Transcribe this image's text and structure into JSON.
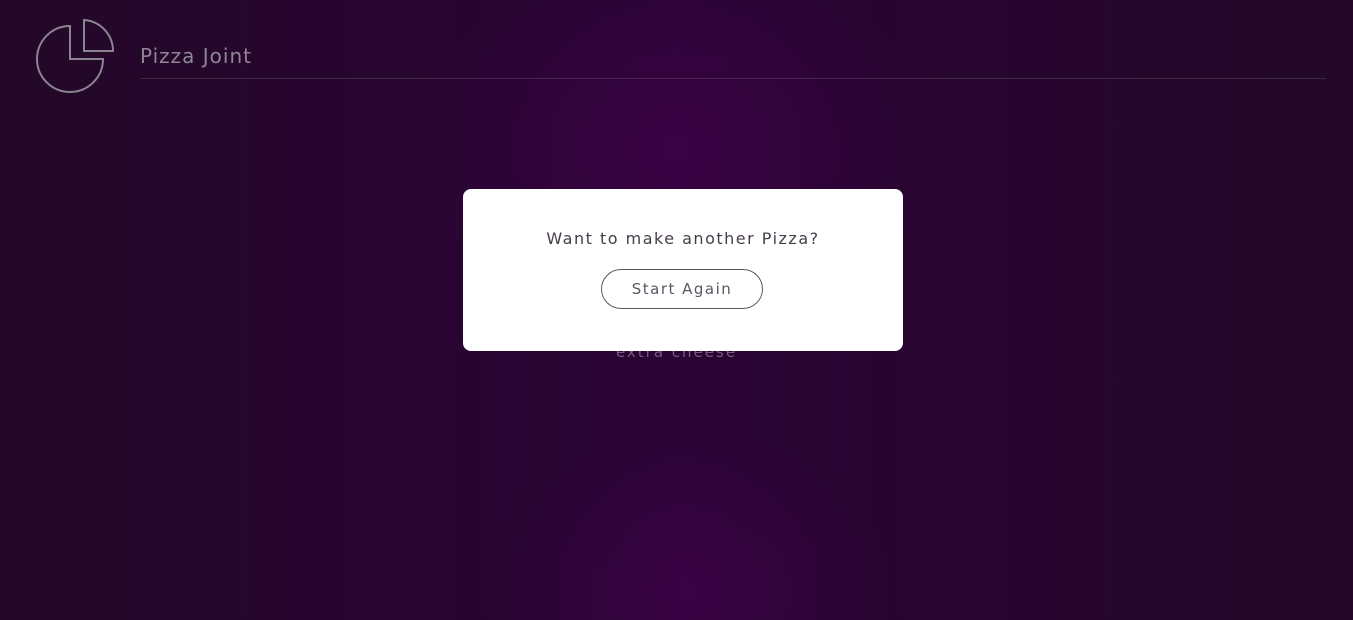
{
  "header": {
    "title": "Pizza Joint",
    "logo_icon": "pizza-slice-icon"
  },
  "background": {
    "topping_text": "extra cheese"
  },
  "modal": {
    "title": "Want to make another Pizza?",
    "button_label": "Start Again"
  },
  "colors": {
    "background": "#2a0435",
    "modal_background": "#ffffff",
    "muted_text": "#8e8595"
  }
}
